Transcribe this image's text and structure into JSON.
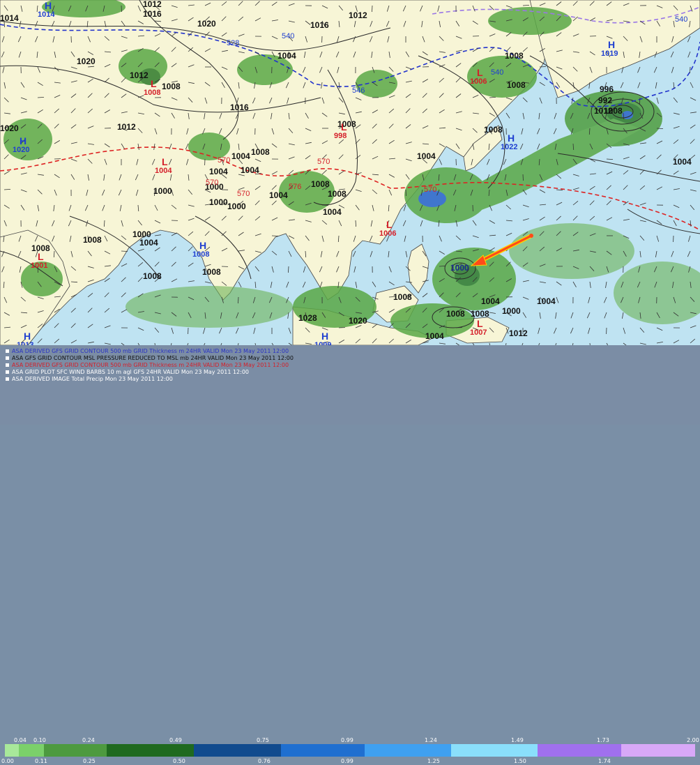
{
  "map": {
    "isobar_labels": [
      "1012",
      "1016",
      "1012",
      "1014",
      "1020",
      "1020",
      "1004",
      "1012",
      "1008",
      "1008",
      "1008",
      "1016",
      "1012",
      "1016",
      "1004",
      "1004",
      "1004",
      "1008",
      "1004",
      "1020",
      "1000",
      "1000",
      "1008",
      "1000",
      "1000",
      "1004",
      "1008",
      "1004",
      "1004",
      "1012",
      "1004",
      "1008",
      "1008",
      "1008",
      "1008",
      "1008",
      "1008",
      "1008",
      "1008",
      "1008",
      "1028",
      "1020",
      "1004",
      "1000",
      "996",
      "992",
      "1012",
      "1008",
      "1004",
      "1000",
      "1004"
    ],
    "thickness_labels": [
      "540",
      "546",
      "528",
      "540",
      "570",
      "570",
      "570",
      "576",
      "570",
      "570",
      "540"
    ],
    "high_centers": [
      {
        "symbol": "H",
        "value": "1014"
      },
      {
        "symbol": "H",
        "value": "1019"
      },
      {
        "symbol": "H",
        "value": "1020"
      },
      {
        "symbol": "H",
        "value": "1022"
      },
      {
        "symbol": "H",
        "value": "1008"
      },
      {
        "symbol": "H",
        "value": "1013"
      },
      {
        "symbol": "H",
        "value": "1009"
      }
    ],
    "low_centers": [
      {
        "symbol": "L",
        "value": "1008"
      },
      {
        "symbol": "L",
        "value": "1006"
      },
      {
        "symbol": "L",
        "value": "998"
      },
      {
        "symbol": "L",
        "value": "1004"
      },
      {
        "symbol": "L",
        "value": "1006"
      },
      {
        "symbol": "L",
        "value": "1001"
      },
      {
        "symbol": "L",
        "value": "1007"
      }
    ],
    "storm_marker": {
      "label": "1000"
    },
    "colors": {
      "land": "#f7f5d6",
      "ocean": "#bfe3f2",
      "precip_light": "#5aa846",
      "precip_dark": "#2f7a2a",
      "precip_blue": "#2a64c8",
      "isobar": "#2a2a2a",
      "thickness_cold": "#2233cc",
      "thickness_warm": "#dd2222",
      "arrow": "#ff4a1a",
      "arrow_outline": "#ffd000"
    }
  },
  "legend": {
    "lines": [
      {
        "text": "ASA DERIVED GFS GRID CONTOUR 500 mb GRID Thickness m 24HR VALID Mon 23 May 2011 12:00",
        "color": "#2a33c4"
      },
      {
        "text": "ASA GFS GRID CONTOUR MSL PRESSURE REDUCED TO MSL mb 24HR VALID Mon 23 May 2011 12:00",
        "color": "#111111"
      },
      {
        "text": "ASA DERIVED GFS GRID CONTOUR 500 mb GRID Thickness m 24HR VALID Mon 23 May 2011 12:00",
        "color": "#d4202a"
      },
      {
        "text": "ASA GRID PLOT SFC WIND BARBS 10 m agl GFS 24HR VALID Mon 23 May 2011 12:00",
        "color": "#ffffff"
      },
      {
        "text": "ASA DERIVED IMAGE Total Precip Mon 23 May 2011 12:00",
        "color": "#ffffff"
      }
    ],
    "scale_top": [
      "0.04",
      "0.10",
      "0.24",
      "0.49",
      "0.75",
      "0.99",
      "1.24",
      "1.49",
      "1.73",
      "2.00"
    ],
    "scale_bottom": [
      "0.00",
      "0.11",
      "0.25",
      "0.50",
      "0.76",
      "0.99",
      "1.25",
      "1.50",
      "1.74"
    ],
    "colorbar": [
      "#a8e89a",
      "#7bd06a",
      "#4d9a3f",
      "#1f6a1f",
      "#114b8e",
      "#1f6fd0",
      "#3fa0f0",
      "#8adffb",
      "#a070ee",
      "#d8a8f8"
    ]
  }
}
